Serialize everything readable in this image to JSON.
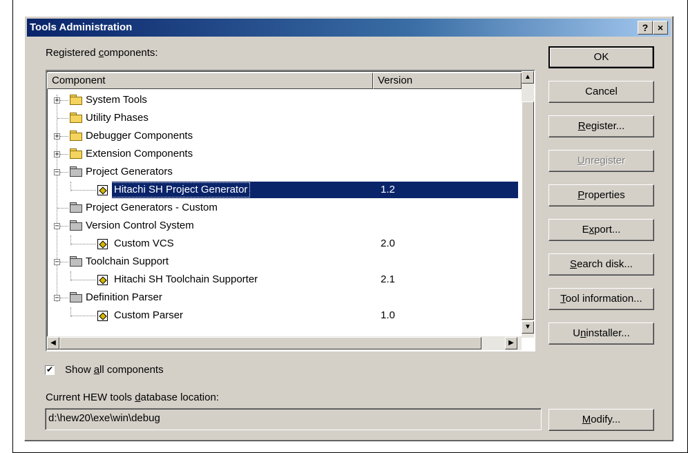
{
  "dialog": {
    "title": "Tools Administration",
    "help_label": "?",
    "close_label": "×"
  },
  "registered_label": {
    "pre": "Registered ",
    "u": "c",
    "post": "omponents:"
  },
  "list": {
    "columns": [
      "Component",
      "Version"
    ],
    "rows": [
      {
        "name": "System Tools",
        "version": ""
      },
      {
        "name": "Utility Phases",
        "version": ""
      },
      {
        "name": "Debugger Components",
        "version": ""
      },
      {
        "name": "Extension Components",
        "version": ""
      },
      {
        "name": "Project Generators",
        "version": ""
      },
      {
        "name": "Hitachi SH Project Generator",
        "version": "1.2"
      },
      {
        "name": "Project Generators - Custom",
        "version": ""
      },
      {
        "name": "Version Control System",
        "version": ""
      },
      {
        "name": "Custom VCS",
        "version": "2.0"
      },
      {
        "name": "Toolchain Support",
        "version": ""
      },
      {
        "name": "Hitachi SH Toolchain Supporter",
        "version": "2.1"
      },
      {
        "name": "Definition Parser",
        "version": ""
      },
      {
        "name": "Custom Parser",
        "version": "1.0"
      }
    ]
  },
  "buttons": {
    "ok": "OK",
    "cancel": "Cancel",
    "register": {
      "u": "R",
      "post": "egister..."
    },
    "unregister": {
      "u": "U",
      "post": "nregister"
    },
    "properties": {
      "u": "P",
      "post": "roperties"
    },
    "export": {
      "pre": "E",
      "u": "x",
      "post": "port..."
    },
    "search": {
      "u": "S",
      "post": "earch disk..."
    },
    "toolinfo": {
      "u": "T",
      "post": "ool information..."
    },
    "uninstaller": {
      "pre": "U",
      "u": "n",
      "post": "installer..."
    },
    "modify": {
      "u": "M",
      "post": "odify..."
    }
  },
  "show_all": {
    "pre": "Show ",
    "u": "a",
    "post": "ll components",
    "checked": true,
    "check_mark": "✔"
  },
  "db_label": {
    "pre": "Current HEW tools ",
    "u": "d",
    "post": "atabase location:"
  },
  "db_path": "d:\\hew20\\exe\\win\\debug",
  "icons": {
    "plus": "+",
    "minus": "−",
    "up": "▲",
    "down": "▼",
    "left": "◀",
    "right": "▶"
  }
}
